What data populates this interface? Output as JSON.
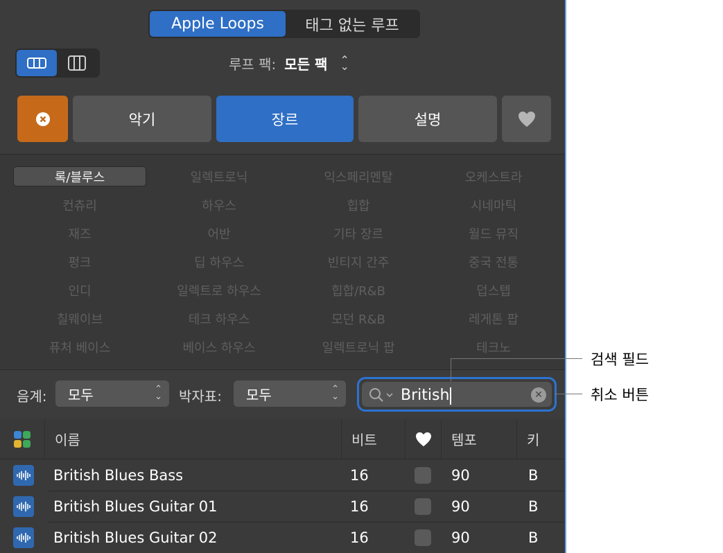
{
  "mode_tabs": [
    "Apple Loops",
    "태그 없는 루프"
  ],
  "loop_pack": {
    "label": "루프 팩:",
    "value": "모든 팩"
  },
  "filter_tabs": [
    "악기",
    "장르",
    "설명"
  ],
  "genres": [
    "록/블루스",
    "일렉트로닉",
    "익스페리멘탈",
    "오케스트라",
    "컨츄리",
    "하우스",
    "힙합",
    "시네마틱",
    "재즈",
    "어반",
    "기타 장르",
    "월드 뮤직",
    "펑크",
    "딥 하우스",
    "빈티지 간주",
    "중국 전통",
    "인디",
    "일렉트로 하우스",
    "힙합/R&B",
    "덥스텝",
    "칠웨이브",
    "테크 하우스",
    "모던 R&B",
    "레게톤 팝",
    "퓨처 베이스",
    "베이스 하우스",
    "일렉트로닉 팝",
    "테크노"
  ],
  "scale": {
    "label": "음계:",
    "value": "모두"
  },
  "time_sig": {
    "label": "박자표:",
    "value": "모두"
  },
  "search": {
    "value": "British"
  },
  "columns": {
    "name": "이름",
    "beats": "비트",
    "tempo": "템포",
    "key": "키"
  },
  "rows": [
    {
      "name": "British Blues Bass",
      "beats": "16",
      "tempo": "90",
      "key": "B"
    },
    {
      "name": "British Blues Guitar 01",
      "beats": "16",
      "tempo": "90",
      "key": "B"
    },
    {
      "name": "British Blues Guitar 02",
      "beats": "16",
      "tempo": "90",
      "key": "B"
    }
  ],
  "callouts": {
    "search_field": "검색 필드",
    "cancel_button": "취소 버튼"
  },
  "colors": {
    "accent": "#2f6fc5",
    "reset": "#c66a1a",
    "panel": "#3a3a3a",
    "focus_ring": "#2c73d2"
  }
}
